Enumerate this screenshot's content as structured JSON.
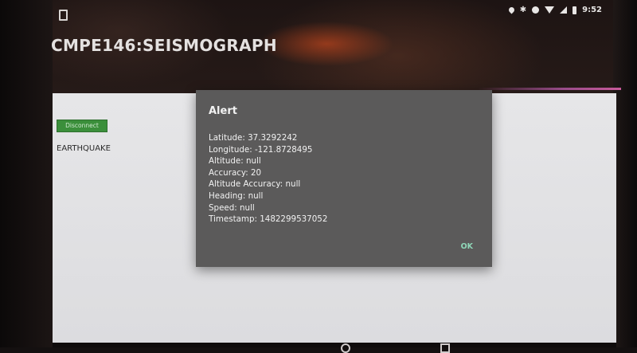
{
  "status_bar": {
    "time": "9:52",
    "icons": [
      "notification-icon",
      "location-icon",
      "bluetooth-icon",
      "dot-icon",
      "wifi-icon",
      "signal-icon",
      "battery-icon"
    ]
  },
  "app": {
    "title": "CMPE146:SEISMOGRAPH",
    "disconnect_label": "Disconnect",
    "earthquake_label": "EARTHQUAKE"
  },
  "alert": {
    "title": "Alert",
    "lines": [
      "Latitude: 37.3292242",
      "Longitude: -121.8728495",
      "Altitude: null",
      "Accuracy: 20",
      "Altitude Accuracy: null",
      "Heading: null",
      "Speed: null",
      "Timestamp: 1482299537052"
    ],
    "ok_label": "OK"
  },
  "colors": {
    "dialog_bg": "#5b5a5a",
    "accent_ok": "#8fd7b8",
    "button_green": "#3b8f3b",
    "content_bg": "#e6e6e8"
  }
}
